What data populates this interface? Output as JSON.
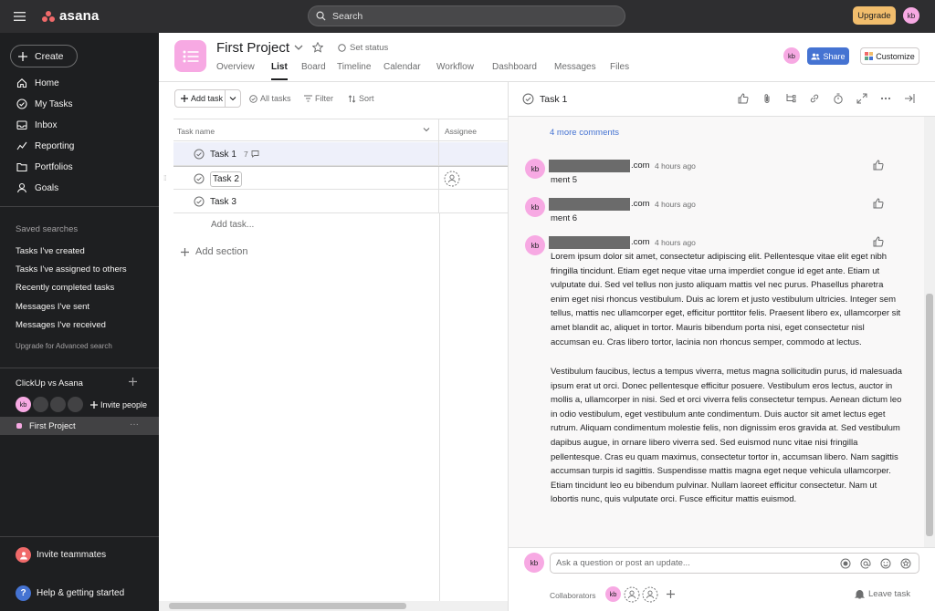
{
  "topbar": {
    "logo_text": "asana",
    "search_placeholder": "Search",
    "upgrade_label": "Upgrade",
    "avatar_initials": "kb"
  },
  "sidebar": {
    "create_label": "Create",
    "nav": [
      {
        "label": "Home",
        "icon": "home-icon"
      },
      {
        "label": "My Tasks",
        "icon": "check-circle-icon"
      },
      {
        "label": "Inbox",
        "icon": "inbox-icon"
      },
      {
        "label": "Reporting",
        "icon": "reporting-icon"
      },
      {
        "label": "Portfolios",
        "icon": "folder-icon"
      },
      {
        "label": "Goals",
        "icon": "person-icon"
      }
    ],
    "saved_searches_heading": "Saved searches",
    "saved_searches": [
      "Tasks I've created",
      "Tasks I've assigned to others",
      "Recently completed tasks",
      "Messages I've sent",
      "Messages I've received"
    ],
    "upgrade_advanced": "Upgrade for Advanced search",
    "team_name": "ClickUp vs Asana",
    "team_avatar_initials": "kb",
    "invite_people": "Invite people",
    "project_name": "First Project",
    "project_menu": "···",
    "invite_teammates": "Invite teammates",
    "help": "Help & getting started"
  },
  "project": {
    "title": "First Project",
    "set_status": "Set status",
    "tabs": [
      "Overview",
      "List",
      "Board",
      "Timeline",
      "Calendar",
      "Workflow",
      "Dashboard",
      "Messages",
      "Files"
    ],
    "active_tab": "List",
    "avatar_initials": "kb",
    "share_label": "Share",
    "customize_label": "Customize"
  },
  "list": {
    "add_task_label": "Add task",
    "all_tasks_label": "All tasks",
    "filter_label": "Filter",
    "sort_label": "Sort",
    "columns": {
      "task_name": "Task name",
      "assignee": "Assignee"
    },
    "tasks": [
      {
        "name": "Task 1",
        "comments": "7"
      },
      {
        "name": "Task 2",
        "comments": ""
      },
      {
        "name": "Task 3",
        "comments": ""
      }
    ],
    "add_task_link": "Add task...",
    "add_section": "Add section"
  },
  "detail": {
    "task_title": "Task 1",
    "more_comments": "4 more comments",
    "comments": [
      {
        "avatar": "kb",
        "name_suffix": ".com",
        "time": "4 hours ago",
        "text": "ment 5"
      },
      {
        "avatar": "kb",
        "name_suffix": ".com",
        "time": "4 hours ago",
        "text": "ment 6"
      },
      {
        "avatar": "kb",
        "name_suffix": ".com",
        "time": "4 hours ago",
        "paragraph1": "Lorem ipsum dolor sit amet, consectetur adipiscing elit. Pellentesque vitae elit eget nibh fringilla tincidunt. Etiam eget neque vitae urna imperdiet congue id eget ante. Etiam ut vulputate dui. Sed vel tellus non justo aliquam mattis vel nec purus. Phasellus pharetra enim eget nisi rhoncus vestibulum. Duis ac lorem et justo vestibulum ultricies. Integer sem tellus, mattis nec ullamcorper eget, efficitur porttitor felis. Praesent libero ex, ullamcorper sit amet blandit ac, aliquet in tortor. Mauris bibendum porta nisi, eget consectetur nisl accumsan eu. Cras libero tortor, lacinia non rhoncus semper, commodo at lectus.",
        "paragraph2": "Vestibulum faucibus, lectus a tempus viverra, metus magna sollicitudin purus, id malesuada ipsum erat ut orci. Donec pellentesque efficitur posuere. Vestibulum eros lectus, auctor in mollis a, ullamcorper in nisi. Sed et orci viverra felis consectetur tempus. Aenean dictum leo in odio vestibulum, eget vestibulum ante condimentum. Duis auctor sit amet lectus eget rutrum. Aliquam condimentum molestie felis, non dignissim eros gravida at. Sed vestibulum dapibus augue, in ornare libero viverra sed. Sed euismod nunc vitae nisi fringilla pellentesque. Cras eu quam maximus, consectetur tortor in, accumsan libero. Nam sagittis accumsan turpis id sagittis. Suspendisse mattis magna eget neque vehicula ullamcorper. Etiam tincidunt leo eu bibendum pulvinar. Nullam laoreet efficitur consectetur. Nam ut lobortis nunc, quis vulputate orci. Fusce efficitur mattis euismod."
      }
    ],
    "composer_avatar": "kb",
    "composer_placeholder": "Ask a question or post an update...",
    "collaborators_label": "Collaborators",
    "collaborator_avatar": "kb",
    "leave_task": "Leave task"
  },
  "colors": {
    "topbar_bg": "#2e2e30",
    "sidebar_bg": "#1e1f21",
    "accent_pink": "#f7a9e3",
    "share_blue": "#4573d2",
    "upgrade_yellow": "#f1bd6c"
  }
}
